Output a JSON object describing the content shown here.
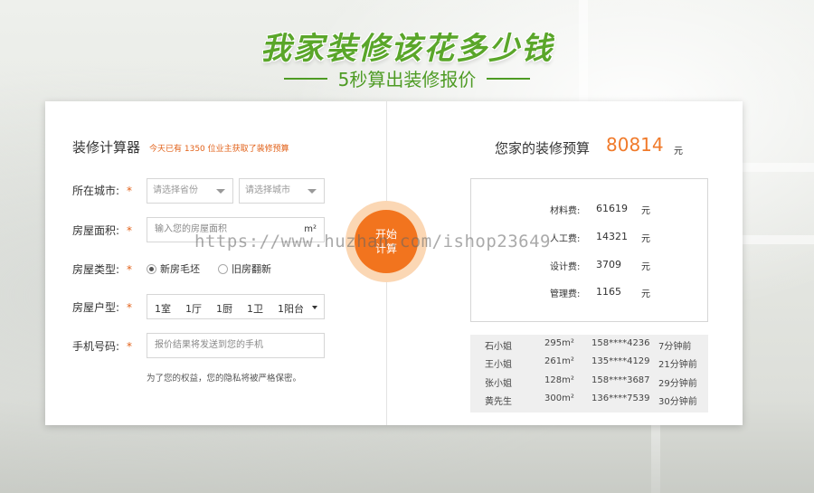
{
  "header": {
    "title": "我家装修该花多少钱",
    "subtitle": "5秒算出装修报价"
  },
  "calculator": {
    "title": "装修计算器",
    "note": "今天已有 1350 位业主获取了装修预算",
    "star": "*",
    "city": {
      "label": "所在城市:",
      "province_placeholder": "请选择省份",
      "city_placeholder": "请选择城市"
    },
    "area": {
      "label": "房屋面积:",
      "placeholder": "输入您的房屋面积",
      "unit": "m²"
    },
    "type": {
      "label": "房屋类型:",
      "option_new": "新房毛坯",
      "option_old": "旧房翻新",
      "selected": "新房毛坯"
    },
    "layout": {
      "label": "房屋户型:",
      "room": "1室",
      "hall": "1厅",
      "kitchen": "1厨",
      "bath": "1卫",
      "balcony": "1阳台"
    },
    "phone": {
      "label": "手机号码:",
      "placeholder": "报价结果将发送到您的手机"
    },
    "privacy": "为了您的权益，您的隐私将被严格保密。",
    "start_button": "开始\n计算"
  },
  "result": {
    "label": "您家的装修预算",
    "value": "80814",
    "unit": "元",
    "fees": [
      {
        "label": "材料费:",
        "value": "61619",
        "unit": "元"
      },
      {
        "label": "人工费:",
        "value": "14321",
        "unit": "元"
      },
      {
        "label": "设计费:",
        "value": "3709",
        "unit": "元"
      },
      {
        "label": "管理费:",
        "value": "1165",
        "unit": "元"
      }
    ],
    "recent": [
      {
        "name": "石小姐",
        "area": "295m²",
        "phone": "158****4236",
        "time": "7分钟前"
      },
      {
        "name": "王小姐",
        "area": "261m²",
        "phone": "135****4129",
        "time": "21分钟前"
      },
      {
        "name": "张小姐",
        "area": "128m²",
        "phone": "158****3687",
        "time": "29分钟前"
      },
      {
        "name": "黄先生",
        "area": "300m²",
        "phone": "136****7539",
        "time": "30分钟前"
      }
    ]
  },
  "watermark": "https://www.huzhan.com/ishop23649",
  "colors": {
    "brand_green": "#5aa62a",
    "accent_orange": "#f2741e"
  }
}
